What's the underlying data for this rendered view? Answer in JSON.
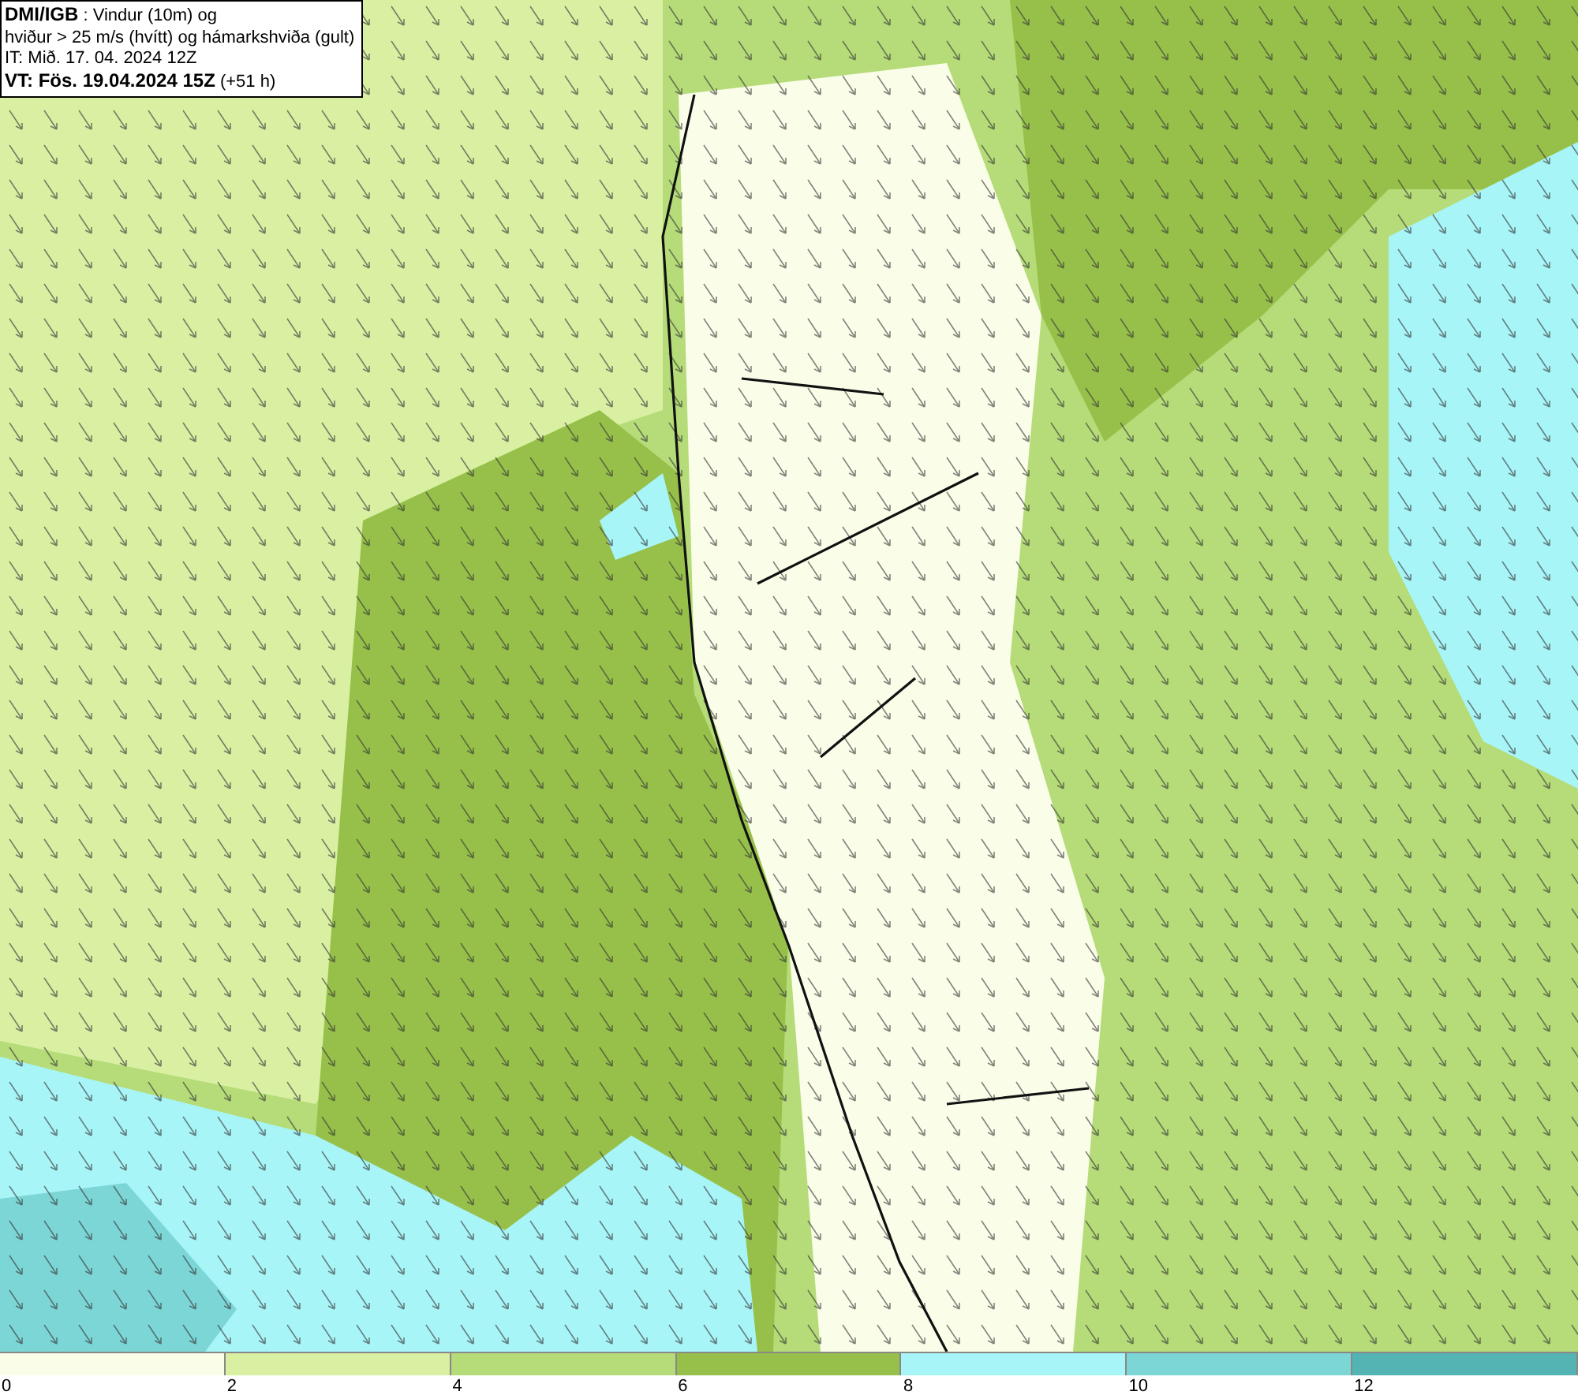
{
  "info_box": {
    "lines": [
      "**DMI/IGB** : Vindur (10m) og",
      "hviður > 25 m/s (hvítt) og hámarkshviða (gult)",
      "IT: Mið. 17. 04. 2024 12Z",
      "**VT: Fös. 19.04.2024 15Z** (+51 h)"
    ]
  },
  "legend": {
    "bins": [
      {
        "color": "#fafde8"
      },
      {
        "color": "#d9f0a3"
      },
      {
        "color": "#b5dc78"
      },
      {
        "color": "#97c04a"
      },
      {
        "color": "#a8f5f8"
      },
      {
        "color": "#7dd6d6"
      },
      {
        "color": "#54b3b3"
      }
    ],
    "ticks": [
      "0",
      "2",
      "4",
      "6",
      "8",
      "10",
      "12"
    ]
  }
}
